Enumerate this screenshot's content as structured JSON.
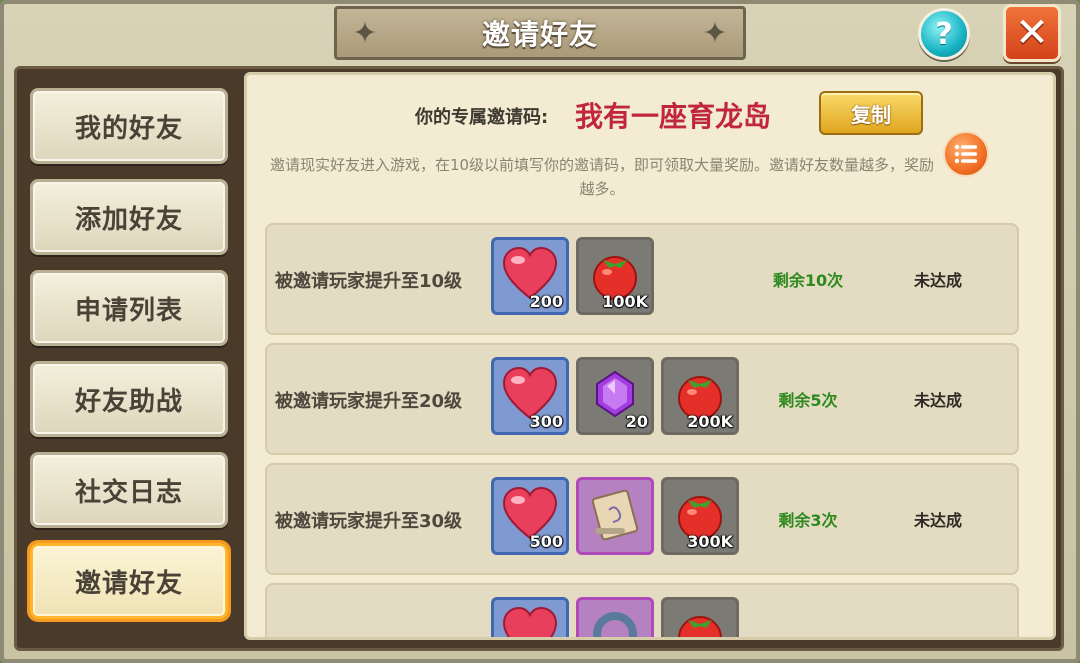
{
  "header": {
    "title": "邀请好友"
  },
  "sidebar": {
    "items": [
      {
        "label": "我的好友",
        "active": false
      },
      {
        "label": "添加好友",
        "active": false
      },
      {
        "label": "申请列表",
        "active": false
      },
      {
        "label": "好友助战",
        "active": false
      },
      {
        "label": "社交日志",
        "active": false
      },
      {
        "label": "邀请好友",
        "active": true
      }
    ]
  },
  "invite": {
    "code_label": "你的专属邀请码:",
    "code_value": "我有一座育龙岛",
    "copy_label": "复制",
    "description": "邀请现实好友进入游戏，在10级以前填写你的邀请码，即可领取大量奖励。邀请好友数量越多，奖励越多。"
  },
  "rewards": [
    {
      "label": "被邀请玩家提升至10级",
      "items": [
        {
          "icon": "heart-icon",
          "count": "200",
          "frame": "blue"
        },
        {
          "icon": "tomato-icon",
          "count": "100K",
          "frame": "gray"
        }
      ],
      "remaining": "剩余10次",
      "status": "未达成"
    },
    {
      "label": "被邀请玩家提升至20级",
      "items": [
        {
          "icon": "heart-icon",
          "count": "300",
          "frame": "blue"
        },
        {
          "icon": "gem-icon",
          "count": "20",
          "frame": "gray"
        },
        {
          "icon": "tomato-icon",
          "count": "200K",
          "frame": "gray"
        }
      ],
      "remaining": "剩余5次",
      "status": "未达成"
    },
    {
      "label": "被邀请玩家提升至30级",
      "items": [
        {
          "icon": "heart-icon",
          "count": "500",
          "frame": "blue"
        },
        {
          "icon": "scroll-icon",
          "count": "",
          "frame": "pink"
        },
        {
          "icon": "tomato-icon",
          "count": "300K",
          "frame": "gray"
        }
      ],
      "remaining": "剩余3次",
      "status": "未达成"
    }
  ],
  "colors": {
    "code_value": "#c0273f",
    "remaining": "#2e8a1e",
    "active_border": "#f59a1e"
  }
}
